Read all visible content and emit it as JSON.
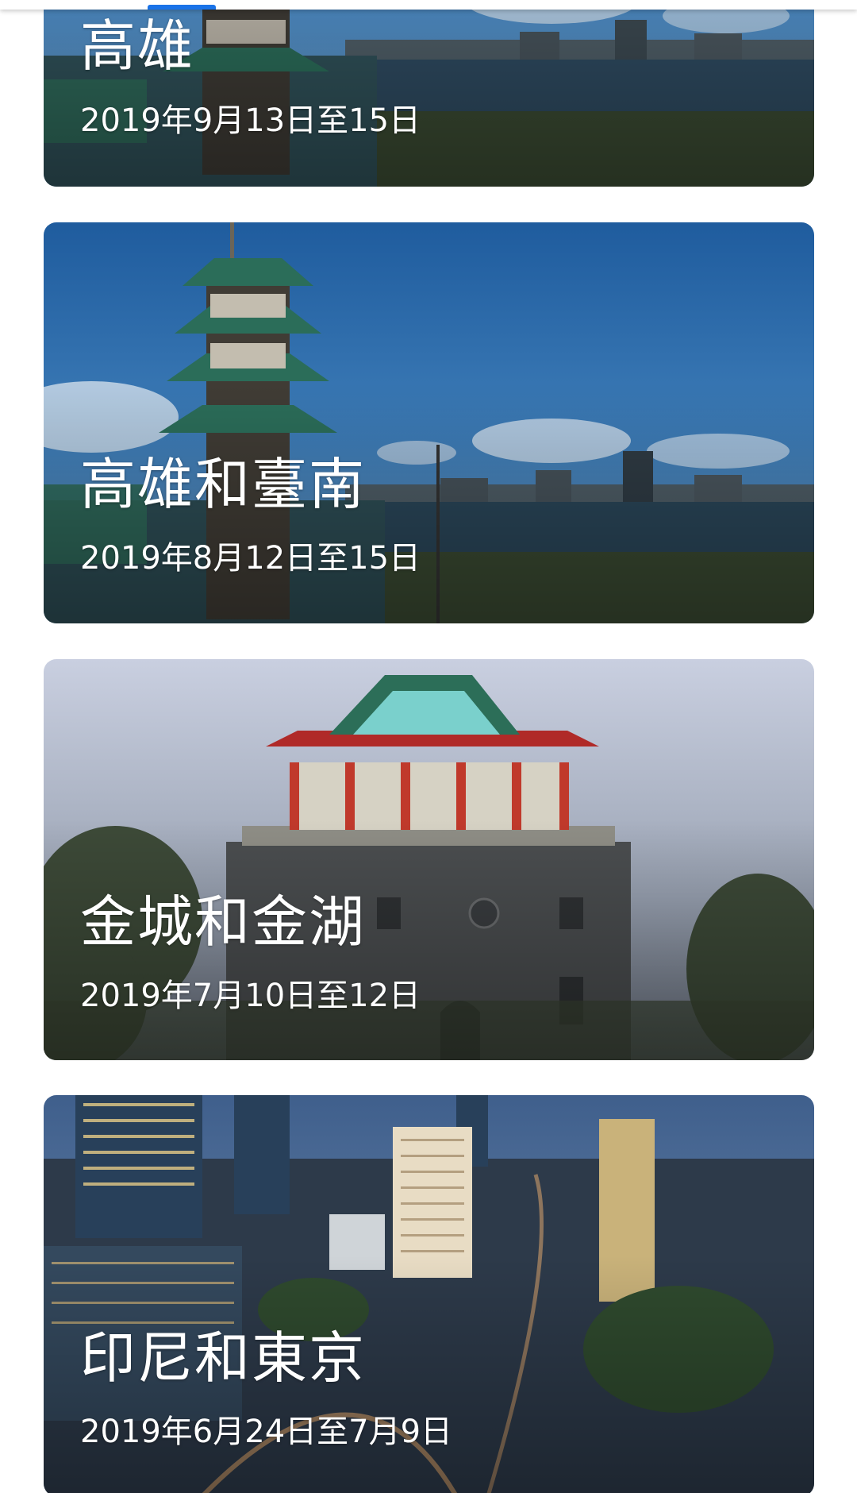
{
  "trips": [
    {
      "title": "高雄",
      "dates": "2019年9月13日至15日",
      "image": "kaohsiung-lotus-pond-pagoda-photo"
    },
    {
      "title": "高雄和臺南",
      "dates": "2019年8月12日至15日",
      "image": "kaohsiung-lotus-pond-pagoda-photo"
    },
    {
      "title": "金城和金湖",
      "dates": "2019年7月10日至12日",
      "image": "kinmen-juguang-tower-photo"
    },
    {
      "title": "印尼和東京",
      "dates": "2019年6月24日至7月9日",
      "image": "jakarta-city-night-skyline-photo"
    }
  ],
  "colors": {
    "tab_indicator": "#1a73e8",
    "card_text": "#ffffff"
  }
}
